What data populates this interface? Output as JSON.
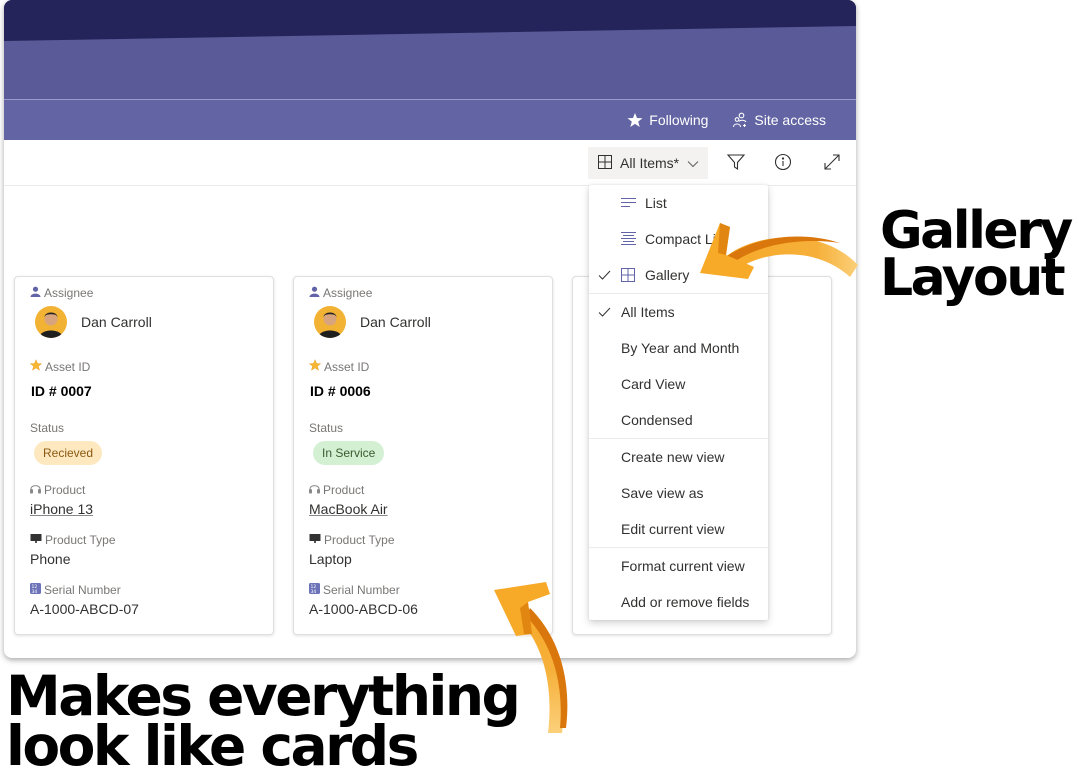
{
  "navbar": {
    "following_label": "Following",
    "site_access_label": "Site access"
  },
  "commandbar": {
    "view_label": "All Items*"
  },
  "cards": [
    {
      "assignee_label": "Assignee",
      "assignee_name": "Dan Carroll",
      "asset_id_label": "Asset ID",
      "asset_id": "ID # 0007",
      "status_label": "Status",
      "status": "Recieved",
      "status_bg": "#fde8c0",
      "status_fg": "#8a5a14",
      "product_label": "Product",
      "product": "iPhone 13",
      "product_type_label": "Product Type",
      "product_type": "Phone",
      "serial_label": "Serial Number",
      "serial": "A-1000-ABCD-07"
    },
    {
      "assignee_label": "Assignee",
      "assignee_name": "Dan Carroll",
      "asset_id_label": "Asset ID",
      "asset_id": "ID # 0006",
      "status_label": "Status",
      "status": "In Service",
      "status_bg": "#d3f0d3",
      "status_fg": "#3b5b2f",
      "product_label": "Product",
      "product": "MacBook Air",
      "product_type_label": "Product Type",
      "product_type": "Laptop",
      "serial_label": "Serial Number",
      "serial": "A-1000-ABCD-06"
    }
  ],
  "view_menu": {
    "layouts": [
      {
        "label": "List",
        "icon": "list-icon",
        "checked": false
      },
      {
        "label": "Compact List",
        "icon": "compact-list-icon",
        "checked": false
      },
      {
        "label": "Gallery",
        "icon": "gallery-icon",
        "checked": true
      }
    ],
    "views": [
      {
        "label": "All Items",
        "checked": true
      },
      {
        "label": "By Year and Month",
        "checked": false
      },
      {
        "label": "Card View",
        "checked": false
      },
      {
        "label": "Condensed",
        "checked": false
      }
    ],
    "actions": [
      {
        "label": "Create new view"
      },
      {
        "label": "Save view as"
      },
      {
        "label": "Edit current view"
      }
    ],
    "format_actions": [
      {
        "label": "Format current view"
      },
      {
        "label": "Add or remove fields"
      }
    ]
  },
  "annotations": {
    "gallery_line1": "Gallery",
    "gallery_line2": "Layout",
    "cards_line1": "Makes everything",
    "cards_line2": "look like cards"
  },
  "colors": {
    "banner_dark": "#24245a",
    "banner": "#5a5a98",
    "navbar": "#6264a3",
    "accent_icon": "#6264a7",
    "arrow_orange": "#f5a623"
  }
}
